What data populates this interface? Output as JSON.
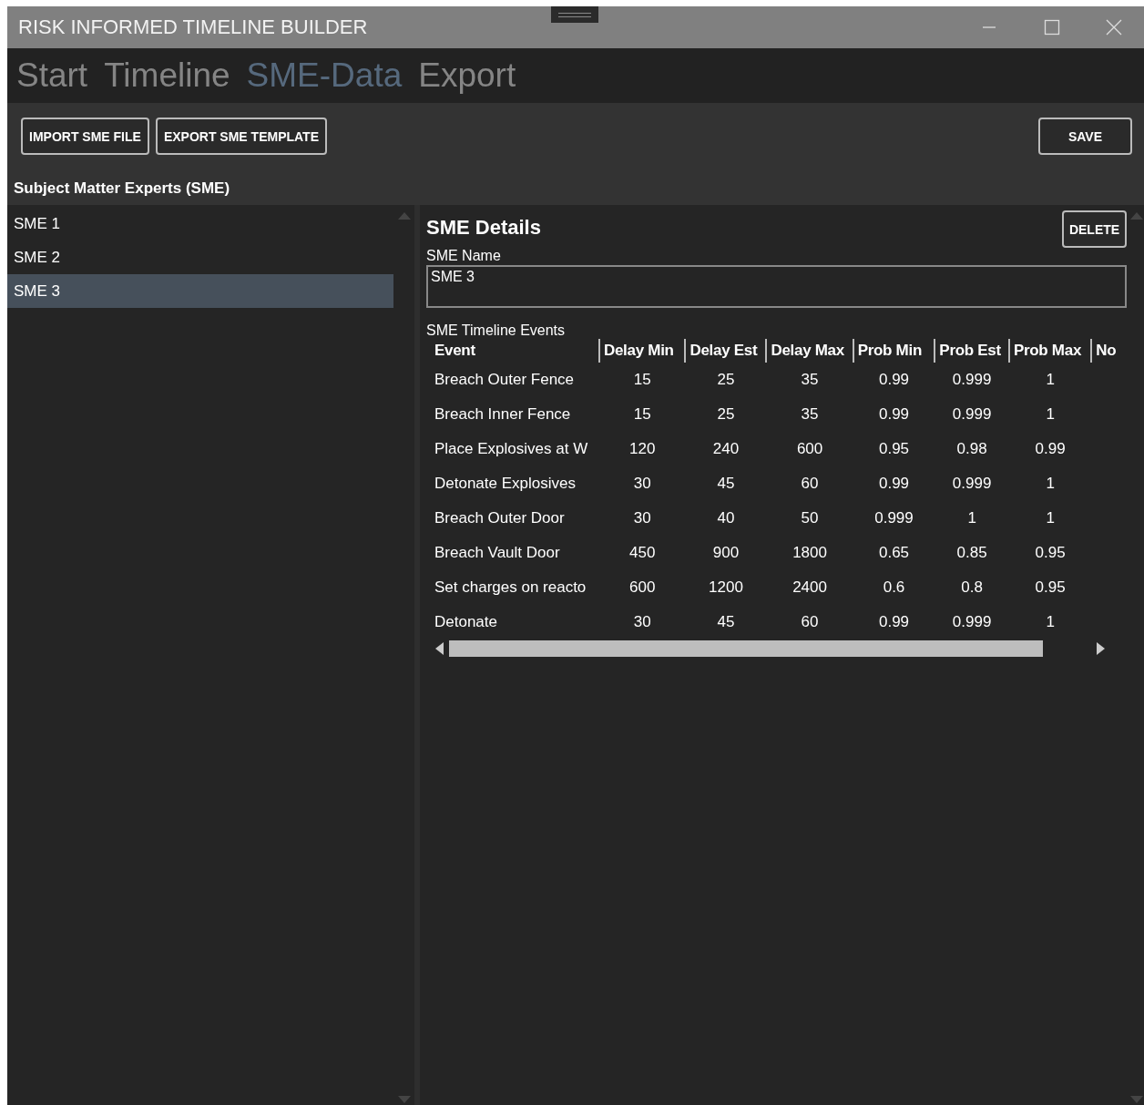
{
  "window": {
    "title": "RISK INFORMED TIMELINE BUILDER"
  },
  "tabs": [
    {
      "label": "Start",
      "selected": false
    },
    {
      "label": "Timeline",
      "selected": false
    },
    {
      "label": "SME-Data",
      "selected": true
    },
    {
      "label": "Export",
      "selected": false
    }
  ],
  "toolbar": {
    "left_buttons": [
      "IMPORT SME FILE",
      "EXPORT SME TEMPLATE"
    ],
    "save_button": "SAVE"
  },
  "sidebar": {
    "heading": "Subject Matter Experts (SME)",
    "items": [
      {
        "label": "SME 1",
        "selected": false
      },
      {
        "label": "SME 2",
        "selected": false
      },
      {
        "label": "SME 3",
        "selected": true
      }
    ]
  },
  "details": {
    "title": "SME Details",
    "delete_button": "DELETE",
    "name_label": "SME Name",
    "name_value": "SME 3",
    "events_label": "SME Timeline Events",
    "table": {
      "columns": [
        "Event",
        "Delay Min",
        "Delay Est",
        "Delay Max",
        "Prob Min",
        "Prob Est",
        "Prob Max",
        "No"
      ],
      "rows": [
        [
          "Breach Outer Fence",
          "15",
          "25",
          "35",
          "0.99",
          "0.999",
          "1"
        ],
        [
          "Breach Inner Fence",
          "15",
          "25",
          "35",
          "0.99",
          "0.999",
          "1"
        ],
        [
          "Place Explosives at W",
          "120",
          "240",
          "600",
          "0.95",
          "0.98",
          "0.99"
        ],
        [
          "Detonate Explosives",
          "30",
          "45",
          "60",
          "0.99",
          "0.999",
          "1"
        ],
        [
          "Breach Outer Door",
          "30",
          "40",
          "50",
          "0.999",
          "1",
          "1"
        ],
        [
          "Breach Vault Door",
          "450",
          "900",
          "1800",
          "0.65",
          "0.85",
          "0.95"
        ],
        [
          "Set charges on reacto",
          "600",
          "1200",
          "2400",
          "0.6",
          "0.8",
          "0.95"
        ],
        [
          "Detonate",
          "30",
          "45",
          "60",
          "0.99",
          "0.999",
          "1"
        ]
      ]
    }
  }
}
